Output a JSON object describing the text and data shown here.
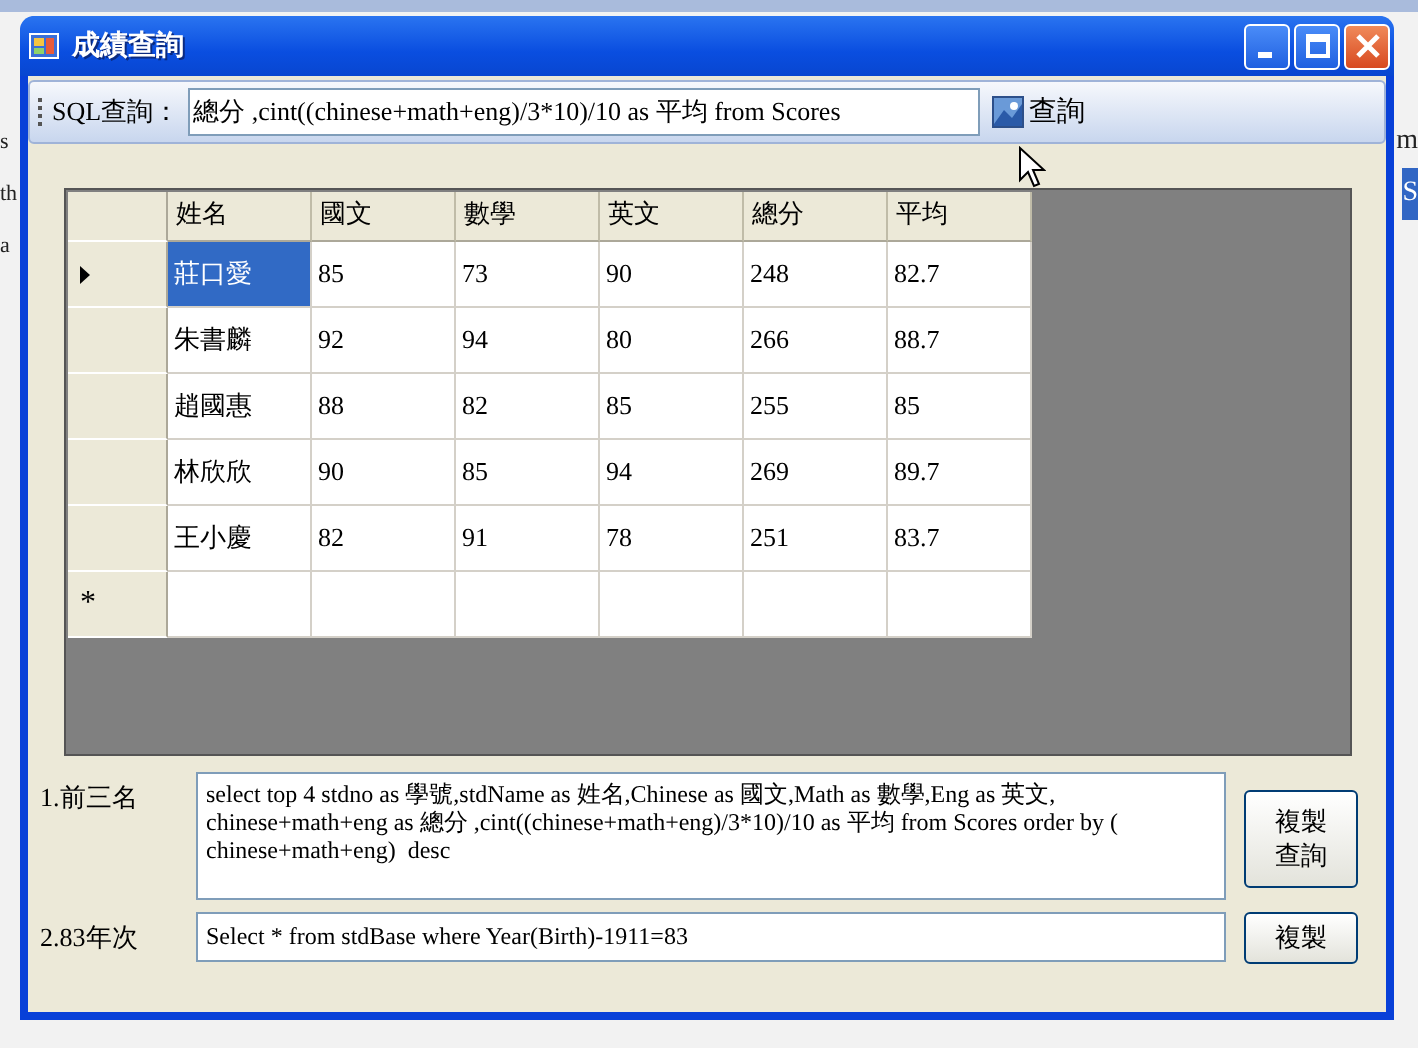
{
  "background": {
    "left_text": [
      "s",
      "th",
      "a"
    ],
    "right_text": [
      {
        "text": "m",
        "selected": false
      },
      {
        "text": "S",
        "selected": true
      }
    ]
  },
  "window": {
    "title": "成績查詢"
  },
  "toolbar": {
    "label": "SQL查詢：",
    "query": "總分 ,cint((chinese+math+eng)/3*10)/10 as 平均 from Scores",
    "button": "查詢"
  },
  "grid": {
    "columns": [
      "姓名",
      "國文",
      "數學",
      "英文",
      "總分",
      "平均"
    ],
    "rows": [
      {
        "current": true,
        "selected": true,
        "cells": [
          "莊口愛",
          "85",
          "73",
          "90",
          "248",
          "82.7"
        ]
      },
      {
        "current": false,
        "selected": false,
        "cells": [
          "朱書麟",
          "92",
          "94",
          "80",
          "266",
          "88.7"
        ]
      },
      {
        "current": false,
        "selected": false,
        "cells": [
          "趙國惠",
          "88",
          "82",
          "85",
          "255",
          "85"
        ]
      },
      {
        "current": false,
        "selected": false,
        "cells": [
          "林欣欣",
          "90",
          "85",
          "94",
          "269",
          "89.7"
        ]
      },
      {
        "current": false,
        "selected": false,
        "cells": [
          "王小慶",
          "82",
          "91",
          "78",
          "251",
          "83.7"
        ]
      }
    ],
    "new_row_mark": "*"
  },
  "queries": [
    {
      "kind": "textarea",
      "label": "1.前三名",
      "text": "select top 4 stdno as 學號,stdName as 姓名,Chinese as 國文,Math as 數學,Eng as 英文, chinese+math+eng as 總分 ,cint((chinese+math+eng)/3*10)/10 as 平均 from Scores order by ( chinese+math+eng)  desc",
      "button": "複製查詢"
    },
    {
      "kind": "field",
      "label": "2.83年次",
      "text": "Select * from stdBase where Year(Birth)-1911=83",
      "button": "複製"
    }
  ]
}
